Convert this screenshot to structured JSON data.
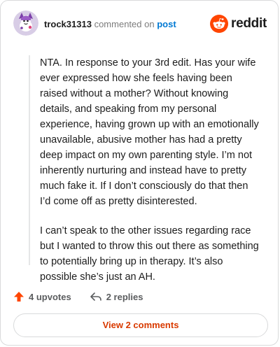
{
  "comment": {
    "username": "trock31313",
    "action_text": "commented on",
    "post_link": "post",
    "paragraphs": [
      "NTA. In response to your 3rd edit. Has your wife ever expressed how she feels having been raised without a mother? Without knowing details, and speaking from my personal experience, having grown up with an emotionally unavailable, abusive mother has had a pretty deep impact on my own parenting style. I’m not inherently nurturing and instead have to pretty much fake it. If I don’t consciously do that then I’d come off as pretty disinterested.",
      "I can’t speak to the other issues regarding race but I wanted to throw this out there as something to potentially bring up in therapy. It’s also possible she’s just an AH."
    ]
  },
  "brand": {
    "wordmark": "reddit",
    "color": "#ff4500"
  },
  "actions": {
    "upvotes": "4 upvotes",
    "replies": "2 replies"
  },
  "footer": {
    "view_comments_label": "View 2 comments"
  },
  "colors": {
    "accent": "#d93a00",
    "link": "#0079d3",
    "upvote": "#ff4500"
  }
}
